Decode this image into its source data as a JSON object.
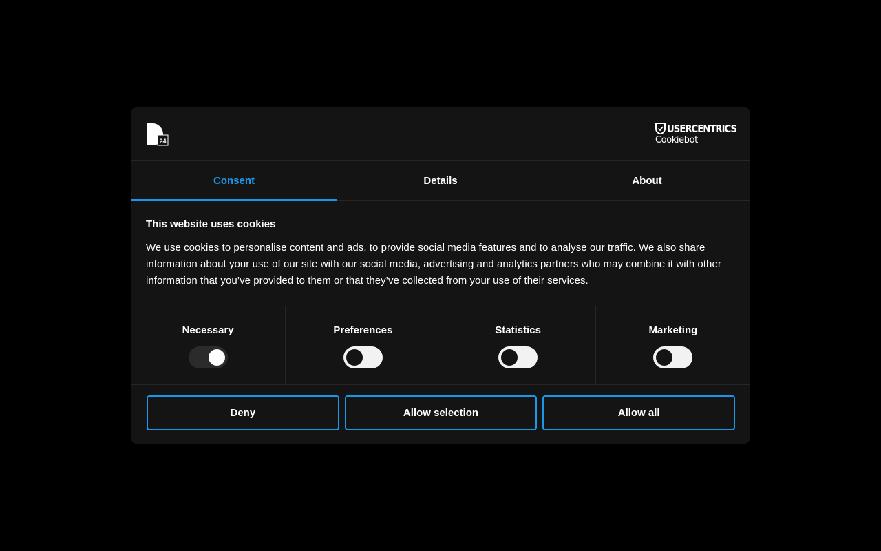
{
  "header": {
    "brand_logo_icon": "d24-logo-icon",
    "brand_logo_text": "24",
    "provider_name": "USERCENTRICS",
    "provider_product": "Cookiebot",
    "provider_icon": "usercentrics-shield-icon"
  },
  "tabs": [
    {
      "label": "Consent",
      "active": true
    },
    {
      "label": "Details",
      "active": false
    },
    {
      "label": "About",
      "active": false
    }
  ],
  "body": {
    "title": "This website uses cookies",
    "text": "We use cookies to personalise content and ads, to provide social media features and to analyse our traffic. We also share information about your use of our site with our social media, advertising and analytics partners who may combine it with other information that you’ve provided to them or that they’ve collected from your use of their services."
  },
  "toggles": [
    {
      "label": "Necessary",
      "checked": true,
      "disabled": true
    },
    {
      "label": "Preferences",
      "checked": false,
      "disabled": false
    },
    {
      "label": "Statistics",
      "checked": false,
      "disabled": false
    },
    {
      "label": "Marketing",
      "checked": false,
      "disabled": false
    }
  ],
  "buttons": {
    "deny": "Deny",
    "allow_selection": "Allow selection",
    "allow_all": "Allow all"
  },
  "colors": {
    "page_background": "#000000",
    "dialog_background": "#141414",
    "accent": "#1a97e8",
    "divider": "#262626",
    "toggle_off_track": "#f2f2f2",
    "toggle_on_track": "#2b2b2b"
  }
}
